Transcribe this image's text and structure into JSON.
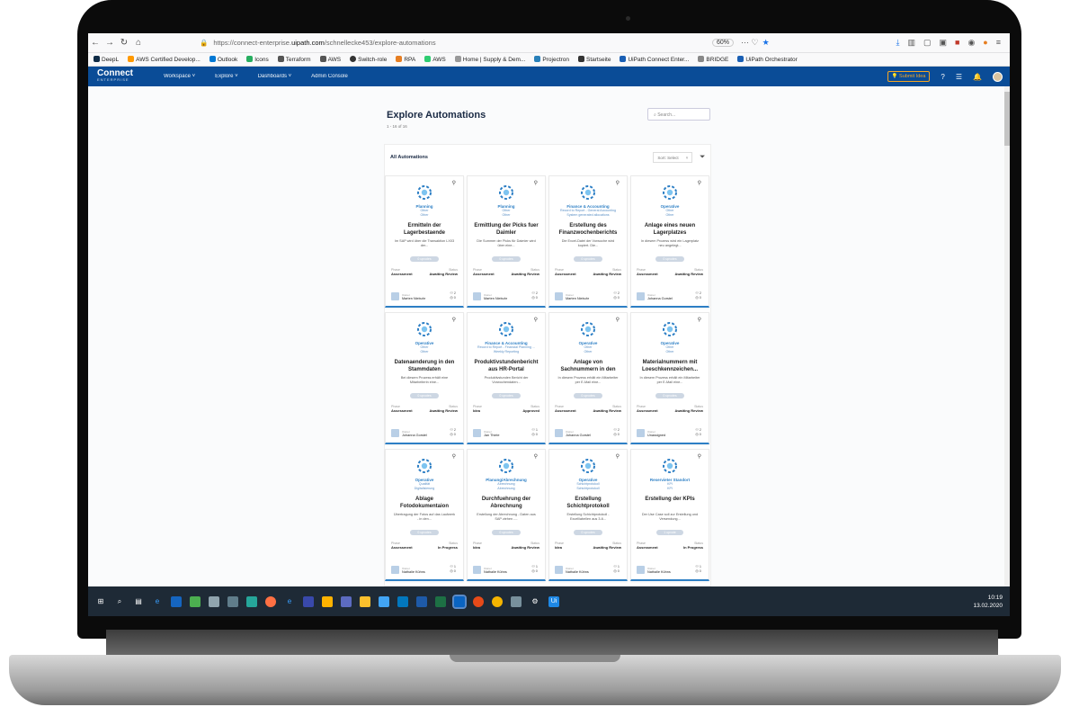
{
  "browser": {
    "url_prefix": "https://connect-enterprise.",
    "url_domain": "uipath.com",
    "url_path": "/schnellecke453/explore-automations",
    "zoom": "60%",
    "bookmarks": [
      "DeepL",
      "AWS Certified Develop...",
      "Outlook",
      "Icons",
      "Terraform",
      "AWS",
      "Switch-role",
      "RPA",
      "AWS",
      "Home | Supply & Dem...",
      "Projectron",
      "Startseite",
      "UiPath Connect Enter...",
      "BRIDGE",
      "UiPath Orchestrator"
    ]
  },
  "app": {
    "logo": "Connect",
    "logo_sub": "ENTERPRISE",
    "menu": [
      "Workspace ˅",
      "Explore ˅",
      "Dashboards ˅",
      "Admin Console"
    ],
    "submit_label": "Submit Idea"
  },
  "page": {
    "title": "Explore Automations",
    "count": "1 - 16 of 16",
    "search_placeholder": "Search...",
    "panel_title": "All Automations",
    "sort_label": "Sort: Select"
  },
  "cards": [
    {
      "category": "Planning",
      "sub1": "Other",
      "sub2": "Other",
      "title": "Ermitteln der Lagerbestaende",
      "desc": "Im SAP wird über die Transaktion LX03 der...",
      "tag": "0 upvotes",
      "phase": "Assessment",
      "status": "Awaiting Review",
      "owner": "Marten Niebuhr",
      "votes": "2",
      "views": "0"
    },
    {
      "category": "Planning",
      "sub1": "Other",
      "sub2": "Other",
      "title": "Ermittlung der Picks fuer Daimler",
      "desc": "Die Summer der Picks für Daimler wird über eine...",
      "tag": "0 upvotes",
      "phase": "Assessment",
      "status": "Awaiting Review",
      "owner": "Marten Niebuhr",
      "votes": "2",
      "views": "0"
    },
    {
      "category": "Finance & Accounting",
      "sub1": "Record to Report - General Accounting",
      "sub2": "System generated allocations",
      "title": "Erstellung des Finanzwochenberichts",
      "desc": "Die Excel-Datei der Vorwoche wird kopiert. Die...",
      "tag": "0 upvotes",
      "phase": "Assessment",
      "status": "Awaiting Review",
      "owner": "Marten Niebuhr",
      "votes": "2",
      "views": "0"
    },
    {
      "category": "Operative",
      "sub1": "Other",
      "sub2": "Other",
      "title": "Anlage eines neuen Lagerplatzes",
      "desc": "In diesem Prozess wird ein Lagerplatz neu angelegt...",
      "tag": "0 upvotes",
      "phase": "Assessment",
      "status": "Awaiting Review",
      "owner": "Johanna Gorstel",
      "votes": "2",
      "views": "0"
    },
    {
      "category": "Operative",
      "sub1": "Other",
      "sub2": "Other",
      "title": "Datenaenderung in den Stammdaten",
      "desc": "Bei diesem Prozess erhält eine Mitarbeiterin eine...",
      "tag": "0 upvotes",
      "phase": "Assessment",
      "status": "Awaiting Review",
      "owner": "Johanna Gorstel",
      "votes": "2",
      "views": "0"
    },
    {
      "category": "Finance & Accounting",
      "sub1": "Record to Report - Financial Planning ...",
      "sub2": "Weekly Reporting",
      "title": "Produktivstundenbericht aus HR-Portal",
      "desc": "Produktivstunden Bericht der Vorwochendaten...",
      "tag": "0 upvotes",
      "phase": "Idea",
      "status": "Approved",
      "owner": "Jan Thiele",
      "votes": "1",
      "views": "0"
    },
    {
      "category": "Operative",
      "sub1": "Other",
      "sub2": "Other",
      "title": "Anlage von Sachnummern in den",
      "desc": "In diesem Prozess erhält ein Mitarbeiter per E-Mail eine...",
      "tag": "0 upvotes",
      "phase": "Assessment",
      "status": "Awaiting Review",
      "owner": "Johanna Gorstel",
      "votes": "2",
      "views": "0"
    },
    {
      "category": "Operative",
      "sub1": "Other",
      "sub2": "Other",
      "title": "Materialnummern mit Loeschkennzeichen...",
      "desc": "In diesem Prozess erhält ein Mitarbeiter per E-Mail eine...",
      "tag": "0 upvotes",
      "phase": "Assessment",
      "status": "Awaiting Review",
      "owner": "Unassigned",
      "votes": "2",
      "views": "0"
    },
    {
      "category": "Operative",
      "sub1": "Qualität",
      "sub2": "Digitalisierung",
      "title": "Ablage Fotodokumentaion",
      "desc": "Übertragung der Fotos auf das Laufwerk - in den...",
      "tag": "0 upvotes",
      "phase": "Assessment",
      "status": "In Progress",
      "owner": "Nathalie Kühns",
      "votes": "1",
      "views": "0"
    },
    {
      "category": "Planung/Abrechnung",
      "sub1": "Abrechnung",
      "sub2": "Abrechnung",
      "title": "Durchfuehrung der Abrechnung",
      "desc": "Erstellung der Abrechnung - Daten aus SAP ziehen -...",
      "tag": "0 upvotes",
      "phase": "Idea",
      "status": "Awaiting Review",
      "owner": "Nathalie Kühns",
      "votes": "1",
      "views": "0"
    },
    {
      "category": "Operative",
      "sub1": "Schichtprotokoll",
      "sub2": "Schichtprotokoll",
      "title": "Erstellung Schichtprotokoll",
      "desc": "Erstellung Schichtprotokoll - Excelliabellen aus 3-6...",
      "tag": "0 upvotes",
      "phase": "Idea",
      "status": "Awaiting Review",
      "owner": "Nathalie Kühns",
      "votes": "1",
      "views": "0"
    },
    {
      "category": "Reservieter Standort",
      "sub1": "KPI",
      "sub2": "KPI",
      "title": "Erstellung der KPIs",
      "desc": "Der Use Case soll zur Erstellung und Versendung...",
      "tag": "1 upvote",
      "phase": "Assessment",
      "status": "In Progress",
      "owner": "Nathalie Kühns",
      "votes": "1",
      "views": "0"
    }
  ],
  "labels": {
    "phase": "Phase",
    "status": "Status",
    "owner": "Owner"
  },
  "taskbar": {
    "time": "10:19",
    "date": "13.02.2020"
  },
  "colors": {
    "header": "#0a4c97",
    "accent": "#2d7fc5",
    "taskbar": "#1e2a36"
  }
}
